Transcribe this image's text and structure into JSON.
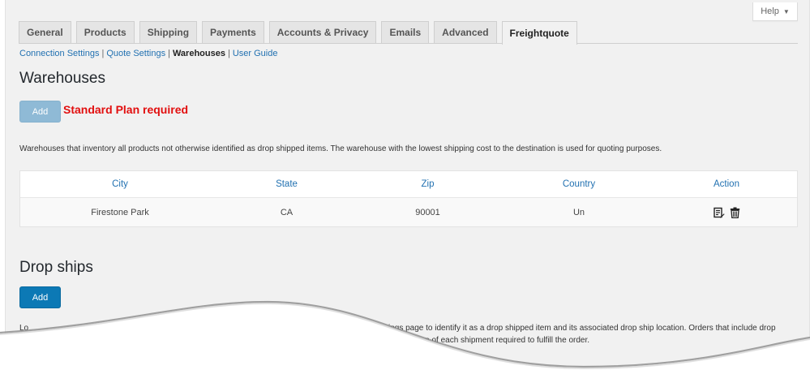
{
  "help": {
    "label": "Help",
    "caret": "▼"
  },
  "tabs": [
    {
      "label": "General",
      "active": false
    },
    {
      "label": "Products",
      "active": false
    },
    {
      "label": "Shipping",
      "active": false
    },
    {
      "label": "Payments",
      "active": false
    },
    {
      "label": "Accounts & Privacy",
      "active": false
    },
    {
      "label": "Emails",
      "active": false
    },
    {
      "label": "Advanced",
      "active": false
    },
    {
      "label": "Freightquote",
      "active": true
    }
  ],
  "subnav": {
    "items": [
      {
        "label": "Connection Settings",
        "current": false
      },
      {
        "label": "Quote Settings",
        "current": false
      },
      {
        "label": "Warehouses",
        "current": true
      },
      {
        "label": "User Guide",
        "current": false
      }
    ],
    "separator": "|"
  },
  "warehouses": {
    "title": "Warehouses",
    "add_label": "Add",
    "plan_note": "Standard Plan required",
    "description": "Warehouses that inventory all products not otherwise identified as drop shipped items. The warehouse with the lowest shipping cost to the destination is used for quoting purposes.",
    "columns": [
      "City",
      "State",
      "Zip",
      "Country",
      "Action"
    ],
    "rows": [
      {
        "city": "Firestone Park",
        "state": "CA",
        "zip": "90001",
        "country": "Un"
      }
    ],
    "action_icons": [
      "edit-icon",
      "trash-icon"
    ]
  },
  "dropships": {
    "title": "Drop ships",
    "add_label": "Add",
    "desc_start": "Lo",
    "desc_line1_end": "ings page to identify it as a drop shipped item and its associated drop ship location. Orders that include drop",
    "desc_line2_end": "ation of each shipment required to fulfill the order."
  },
  "colors": {
    "background": "#f1f1f1",
    "link": "#2271b1",
    "primary_button": "#0c79b5",
    "disabled_button": "#8fbad6",
    "warning_text": "#e20f0f"
  }
}
